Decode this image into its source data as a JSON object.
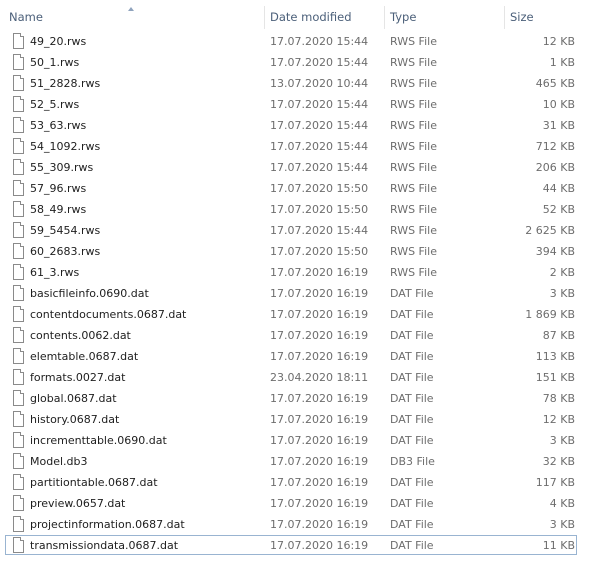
{
  "columns": {
    "name": "Name",
    "date_modified": "Date modified",
    "type": "Type",
    "size": "Size"
  },
  "sort": {
    "column": "name",
    "direction": "ascending"
  },
  "files": [
    {
      "name": "49_20.rws",
      "date": "17.07.2020 15:44",
      "type": "RWS File",
      "size": "12 KB"
    },
    {
      "name": "50_1.rws",
      "date": "17.07.2020 15:44",
      "type": "RWS File",
      "size": "1 KB"
    },
    {
      "name": "51_2828.rws",
      "date": "13.07.2020 10:44",
      "type": "RWS File",
      "size": "465 KB"
    },
    {
      "name": "52_5.rws",
      "date": "17.07.2020 15:44",
      "type": "RWS File",
      "size": "10 KB"
    },
    {
      "name": "53_63.rws",
      "date": "17.07.2020 15:44",
      "type": "RWS File",
      "size": "31 KB"
    },
    {
      "name": "54_1092.rws",
      "date": "17.07.2020 15:44",
      "type": "RWS File",
      "size": "712 KB"
    },
    {
      "name": "55_309.rws",
      "date": "17.07.2020 15:44",
      "type": "RWS File",
      "size": "206 KB"
    },
    {
      "name": "57_96.rws",
      "date": "17.07.2020 15:50",
      "type": "RWS File",
      "size": "44 KB"
    },
    {
      "name": "58_49.rws",
      "date": "17.07.2020 15:50",
      "type": "RWS File",
      "size": "52 KB"
    },
    {
      "name": "59_5454.rws",
      "date": "17.07.2020 15:44",
      "type": "RWS File",
      "size": "2 625 KB"
    },
    {
      "name": "60_2683.rws",
      "date": "17.07.2020 15:50",
      "type": "RWS File",
      "size": "394 KB"
    },
    {
      "name": "61_3.rws",
      "date": "17.07.2020 16:19",
      "type": "RWS File",
      "size": "2 KB"
    },
    {
      "name": "basicfileinfo.0690.dat",
      "date": "17.07.2020 16:19",
      "type": "DAT File",
      "size": "3 KB"
    },
    {
      "name": "contentdocuments.0687.dat",
      "date": "17.07.2020 16:19",
      "type": "DAT File",
      "size": "1 869 KB"
    },
    {
      "name": "contents.0062.dat",
      "date": "17.07.2020 16:19",
      "type": "DAT File",
      "size": "87 KB"
    },
    {
      "name": "elemtable.0687.dat",
      "date": "17.07.2020 16:19",
      "type": "DAT File",
      "size": "113 KB"
    },
    {
      "name": "formats.0027.dat",
      "date": "23.04.2020 18:11",
      "type": "DAT File",
      "size": "151 KB"
    },
    {
      "name": "global.0687.dat",
      "date": "17.07.2020 16:19",
      "type": "DAT File",
      "size": "78 KB"
    },
    {
      "name": "history.0687.dat",
      "date": "17.07.2020 16:19",
      "type": "DAT File",
      "size": "12 KB"
    },
    {
      "name": "incrementtable.0690.dat",
      "date": "17.07.2020 16:19",
      "type": "DAT File",
      "size": "3 KB"
    },
    {
      "name": "Model.db3",
      "date": "17.07.2020 16:19",
      "type": "DB3 File",
      "size": "32 KB"
    },
    {
      "name": "partitiontable.0687.dat",
      "date": "17.07.2020 16:19",
      "type": "DAT File",
      "size": "117 KB"
    },
    {
      "name": "preview.0657.dat",
      "date": "17.07.2020 16:19",
      "type": "DAT File",
      "size": "4 KB"
    },
    {
      "name": "projectinformation.0687.dat",
      "date": "17.07.2020 16:19",
      "type": "DAT File",
      "size": "3 KB"
    },
    {
      "name": "transmissiondata.0687.dat",
      "date": "17.07.2020 16:19",
      "type": "DAT File",
      "size": "11 KB"
    }
  ],
  "focused_index": 24,
  "icon": "generic-file-icon"
}
